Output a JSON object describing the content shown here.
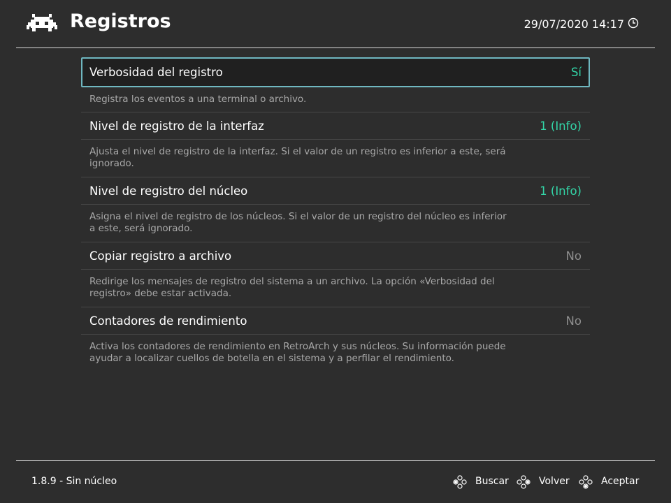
{
  "header": {
    "title": "Registros",
    "datetime": "29/07/2020 14:17",
    "logo_icon": "retroarch-invader-icon",
    "clock_icon": "clock-icon"
  },
  "settings": [
    {
      "label": "Verbosidad del registro",
      "value": "Sí",
      "state": "on",
      "selected": true,
      "description": "Registra los eventos a una terminal o archivo."
    },
    {
      "label": "Nivel de registro de la interfaz",
      "value": "1 (Info)",
      "state": "on",
      "description": "Ajusta el nivel de registro de la interfaz. Si el valor de un registro es inferior a este, será ignorado."
    },
    {
      "label": "Nivel de registro del núcleo",
      "value": "1 (Info)",
      "state": "on",
      "description": "Asigna el nivel de registro de los núcleos. Si el valor de un registro del núcleo es inferior a este, será ignorado."
    },
    {
      "label": "Copiar registro a archivo",
      "value": "No",
      "state": "off",
      "description": "Redirige los mensajes de registro del sistema a un archivo. La opción «Verbosidad del registro» debe estar activada."
    },
    {
      "label": "Contadores de rendimiento",
      "value": "No",
      "state": "off",
      "description": "Activa los contadores de rendimiento en RetroArch y sus núcleos. Su información puede ayudar a localizar cuellos de botella en el sistema y a perfilar el rendimiento."
    }
  ],
  "footer": {
    "version": "1.8.9 - Sin núcleo",
    "hints": [
      {
        "label": "Buscar",
        "icon": "gamepad-buttons-icon"
      },
      {
        "label": "Volver",
        "icon": "gamepad-buttons-icon"
      },
      {
        "label": "Aceptar",
        "icon": "gamepad-buttons-icon"
      }
    ]
  },
  "colors": {
    "background": "#2d2d2d",
    "selection_border": "#6fb7c0",
    "value_on": "#33d6a8",
    "value_off": "#8e8e8e",
    "description": "#a8a8a8"
  }
}
